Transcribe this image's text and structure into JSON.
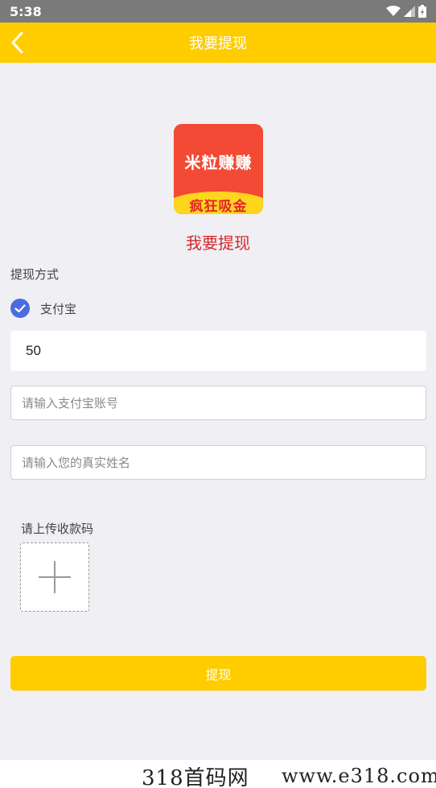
{
  "status_bar": {
    "time": "5:38"
  },
  "header": {
    "title": "我要提现"
  },
  "logo": {
    "top_text": "米粒赚赚",
    "bottom_text": "疯狂吸金"
  },
  "page_title": "我要提现",
  "withdraw": {
    "method_label": "提现方式",
    "method_option": "支付宝",
    "amount": "50",
    "account_placeholder": "请输入支付宝账号",
    "name_placeholder": "请输入您的真实姓名",
    "upload_label": "请上传收款码",
    "submit_label": "提现"
  },
  "watermark": {
    "left": "318首码网",
    "right": "www.e318.com"
  },
  "colors": {
    "accent": "#ffcc00",
    "check": "#4a6ce0",
    "title_red": "#d6282c"
  }
}
